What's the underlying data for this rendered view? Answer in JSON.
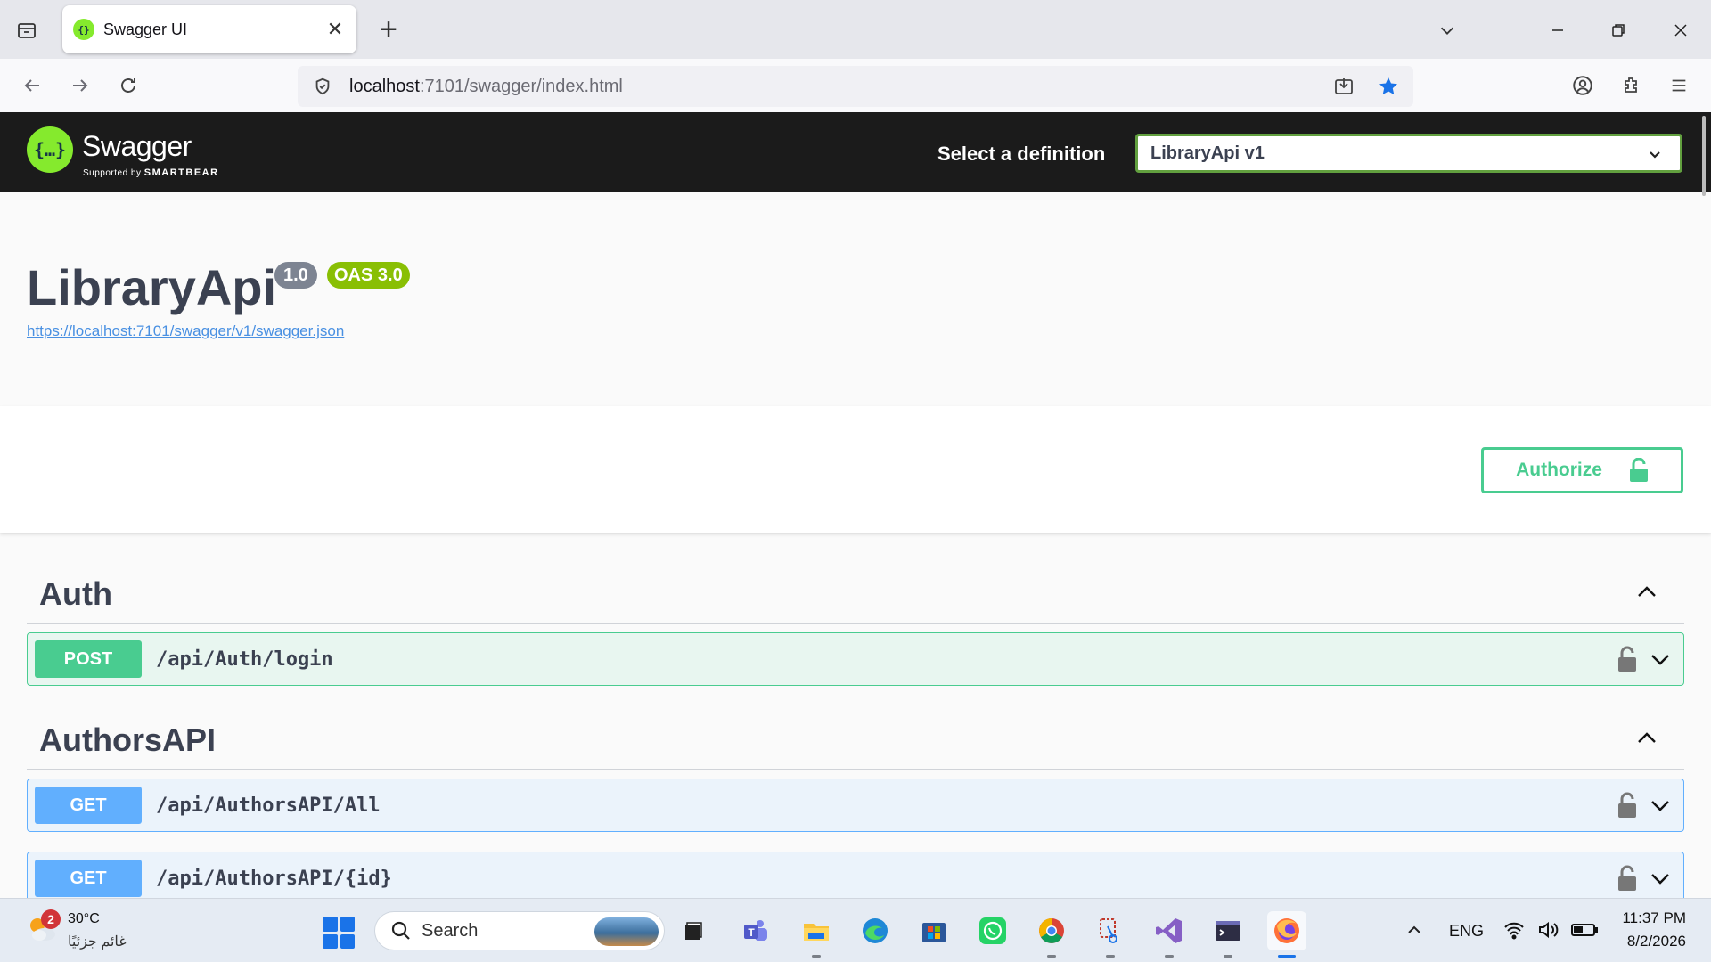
{
  "browser": {
    "tab_title": "Swagger UI",
    "url_host": "localhost",
    "url_rest": ":7101/swagger/index.html"
  },
  "swagger": {
    "brand": "Swagger",
    "supported_by": "Supported by",
    "smartbear": "SMARTBEAR",
    "definition_label": "Select a definition",
    "definition_value": "LibraryApi v1"
  },
  "info": {
    "title": "LibraryApi",
    "version": "1.0",
    "oas": "OAS 3.0",
    "spec_url": "https://localhost:7101/swagger/v1/swagger.json"
  },
  "authorize_label": "Authorize",
  "tags": [
    {
      "name": "Auth"
    },
    {
      "name": "AuthorsAPI"
    }
  ],
  "operations": [
    {
      "method": "POST",
      "path": "/api/Auth/login"
    },
    {
      "method": "GET",
      "path": "/api/AuthorsAPI/All"
    },
    {
      "method": "GET",
      "path": "/api/AuthorsAPI/{id}"
    }
  ],
  "taskbar": {
    "weather_badge": "2",
    "temperature": "30°C",
    "weather_desc": "غائم جزئيًا",
    "search_label": "Search",
    "language": "ENG",
    "time": "11:37 PM",
    "date": "8/2/2026"
  },
  "colors": {
    "post": "#49cc90",
    "get": "#61affe",
    "swagger_green": "#85ea2d",
    "topbar": "#1b1b1b"
  }
}
